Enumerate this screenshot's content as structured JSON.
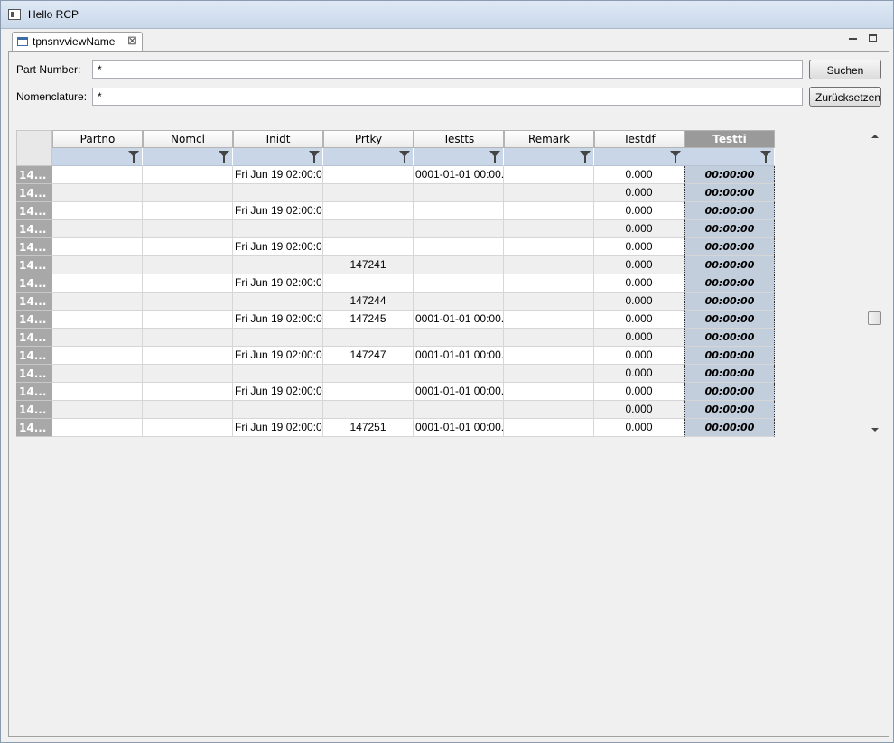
{
  "window": {
    "title": "Hello RCP"
  },
  "tab": {
    "label": "tpnsnvviewName"
  },
  "form": {
    "part_number_label": "Part Number:",
    "part_number_value": "*",
    "nomenclature_label": "Nomenclature:",
    "nomenclature_value": "*",
    "search_button": "Suchen",
    "reset_button": "Zurücksetzen"
  },
  "table": {
    "columns": [
      "Partno",
      "Nomcl",
      "Inidt",
      "Prtky",
      "Testts",
      "Remark",
      "Testdf",
      "Testti"
    ],
    "selected_column": "Testti",
    "rows": [
      {
        "id": "14...",
        "partno": "",
        "nomcl": "",
        "inidt": "Fri Jun 19 02:00:0...",
        "prtky": "",
        "testts": "0001-01-01 00:00...",
        "remark": "",
        "testdf": "0.000",
        "testti": "00:00:00"
      },
      {
        "id": "14...",
        "partno": "",
        "nomcl": "",
        "inidt": "",
        "prtky": "",
        "testts": "",
        "remark": "",
        "testdf": "0.000",
        "testti": "00:00:00"
      },
      {
        "id": "14...",
        "partno": "",
        "nomcl": "",
        "inidt": "Fri Jun 19 02:00:0...",
        "prtky": "",
        "testts": "",
        "remark": "",
        "testdf": "0.000",
        "testti": "00:00:00"
      },
      {
        "id": "14...",
        "partno": "",
        "nomcl": "",
        "inidt": "",
        "prtky": "",
        "testts": "",
        "remark": "",
        "testdf": "0.000",
        "testti": "00:00:00"
      },
      {
        "id": "14...",
        "partno": "",
        "nomcl": "",
        "inidt": "Fri Jun 19 02:00:0...",
        "prtky": "",
        "testts": "",
        "remark": "",
        "testdf": "0.000",
        "testti": "00:00:00"
      },
      {
        "id": "14...",
        "partno": "",
        "nomcl": "",
        "inidt": "",
        "prtky": "147241",
        "testts": "",
        "remark": "",
        "testdf": "0.000",
        "testti": "00:00:00"
      },
      {
        "id": "14...",
        "partno": "",
        "nomcl": "",
        "inidt": "Fri Jun 19 02:00:0...",
        "prtky": "",
        "testts": "",
        "remark": "",
        "testdf": "0.000",
        "testti": "00:00:00"
      },
      {
        "id": "14...",
        "partno": "",
        "nomcl": "",
        "inidt": "",
        "prtky": "147244",
        "testts": "",
        "remark": "",
        "testdf": "0.000",
        "testti": "00:00:00"
      },
      {
        "id": "14...",
        "partno": "",
        "nomcl": "",
        "inidt": "Fri Jun 19 02:00:0...",
        "prtky": "147245",
        "testts": "0001-01-01 00:00...",
        "remark": "",
        "testdf": "0.000",
        "testti": "00:00:00"
      },
      {
        "id": "14...",
        "partno": "",
        "nomcl": "",
        "inidt": "",
        "prtky": "",
        "testts": "",
        "remark": "",
        "testdf": "0.000",
        "testti": "00:00:00"
      },
      {
        "id": "14...",
        "partno": "",
        "nomcl": "",
        "inidt": "Fri Jun 19 02:00:0...",
        "prtky": "147247",
        "testts": "0001-01-01 00:00...",
        "remark": "",
        "testdf": "0.000",
        "testti": "00:00:00"
      },
      {
        "id": "14...",
        "partno": "",
        "nomcl": "",
        "inidt": "",
        "prtky": "",
        "testts": "",
        "remark": "",
        "testdf": "0.000",
        "testti": "00:00:00"
      },
      {
        "id": "14...",
        "partno": "",
        "nomcl": "",
        "inidt": "Fri Jun 19 02:00:0...",
        "prtky": "",
        "testts": "0001-01-01 00:00...",
        "remark": "",
        "testdf": "0.000",
        "testti": "00:00:00"
      },
      {
        "id": "14...",
        "partno": "",
        "nomcl": "",
        "inidt": "",
        "prtky": "",
        "testts": "",
        "remark": "",
        "testdf": "0.000",
        "testti": "00:00:00"
      },
      {
        "id": "14...",
        "partno": "",
        "nomcl": "",
        "inidt": "Fri Jun 19 02:00:0...",
        "prtky": "147251",
        "testts": "0001-01-01 00:00...",
        "remark": "",
        "testdf": "0.000",
        "testti": "00:00:00"
      }
    ]
  },
  "colors": {
    "filter_row": "#c8d6e8",
    "row_header": "#a8a8a8",
    "selected_column": "#c2cedc",
    "alt_row": "#efefef"
  },
  "icons": {
    "tab": "view-icon",
    "close": "close-icon",
    "filter": "filter-icon",
    "minimize": "minimize-icon",
    "maximize": "maximize-icon"
  }
}
